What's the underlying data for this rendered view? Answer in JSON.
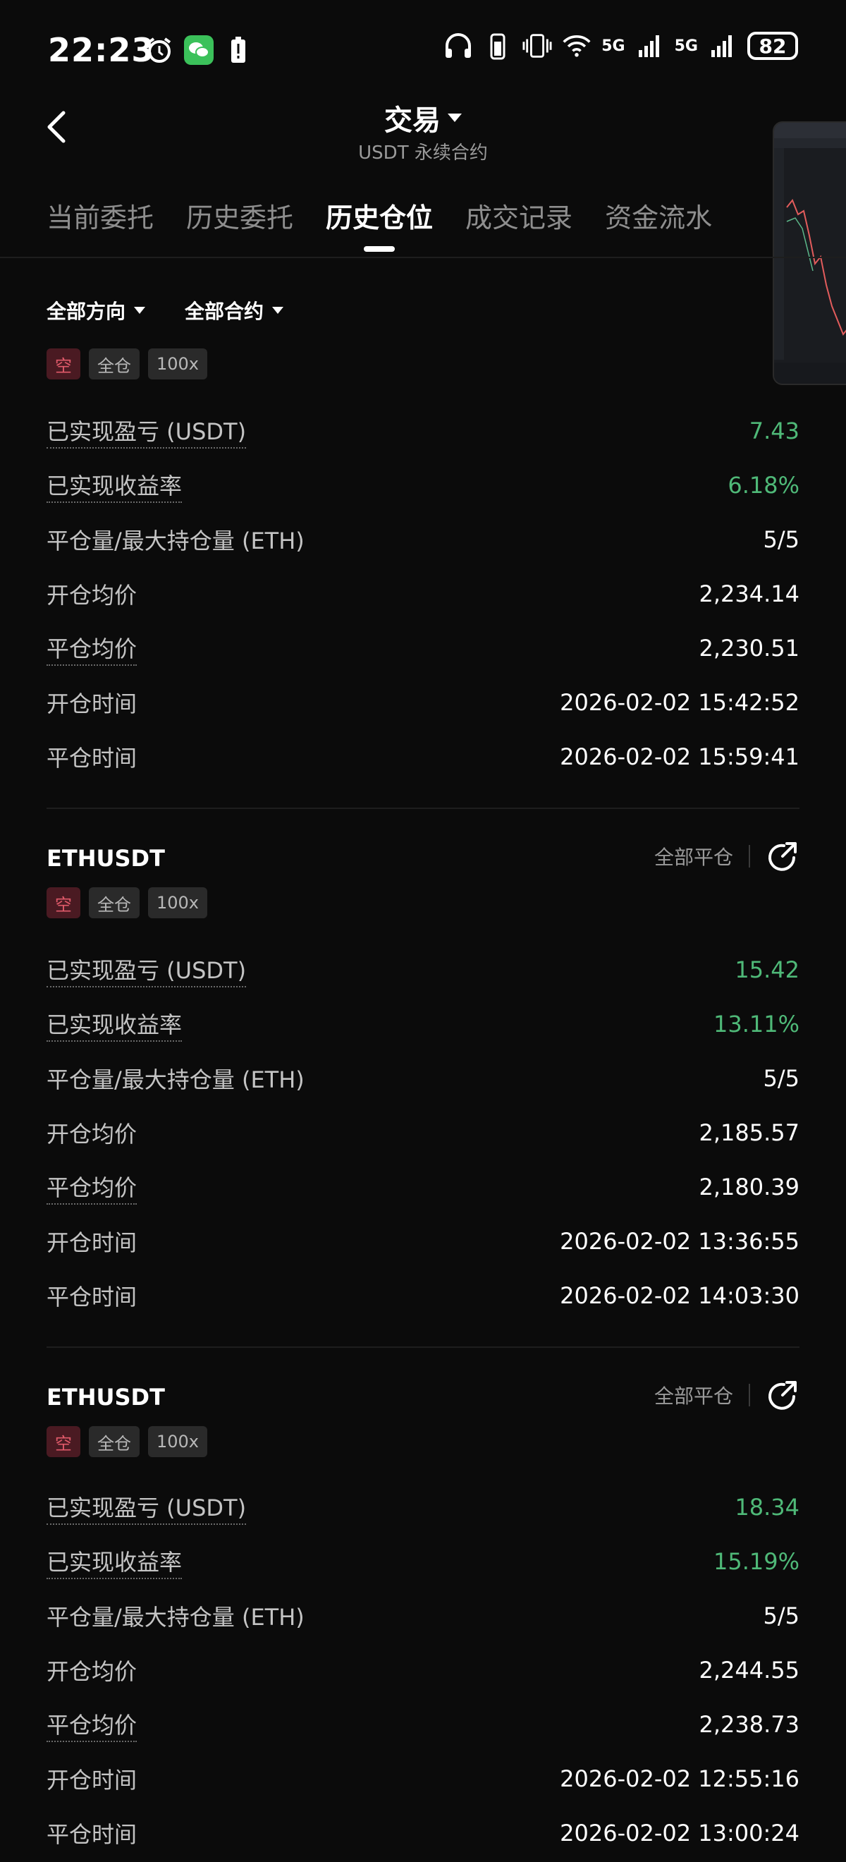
{
  "status_bar": {
    "time": "22:23",
    "network1": "5G",
    "network2": "5G",
    "battery": "82",
    "icons": [
      "alarm-icon",
      "wechat-icon",
      "battery-alert-icon",
      "headphones-icon",
      "watch-battery-icon",
      "vibrate-icon",
      "wifi-icon",
      "signal-icon",
      "signal-icon"
    ]
  },
  "header": {
    "title": "交易",
    "subtitle": "USDT 永续合约"
  },
  "tabs": [
    {
      "label": "当前委托"
    },
    {
      "label": "历史委托"
    },
    {
      "label": "历史仓位",
      "active": true
    },
    {
      "label": "成交记录"
    },
    {
      "label": "资金流水"
    }
  ],
  "filters": {
    "direction": "全部方向",
    "contract": "全部合约"
  },
  "labels": {
    "close_all": "全部平仓"
  },
  "positions": [
    {
      "symbol": "",
      "tags": [
        "空",
        "全仓",
        "100x"
      ],
      "rows": [
        {
          "label": "已实现盈亏 (USDT)",
          "value": "7.43"
        },
        {
          "label": "已实现收益率",
          "value": "6.18%"
        },
        {
          "label": "平仓量/最大持仓量 (ETH)",
          "value": "5/5"
        },
        {
          "label": "开仓均价",
          "value": "2,234.14"
        },
        {
          "label": "平仓均价",
          "value": "2,230.51"
        },
        {
          "label": "开仓时间",
          "value": "2026-02-02 15:42:52"
        },
        {
          "label": "平仓时间",
          "value": "2026-02-02 15:59:41"
        }
      ]
    },
    {
      "symbol": "ETHUSDT",
      "tags": [
        "空",
        "全仓",
        "100x"
      ],
      "rows": [
        {
          "label": "已实现盈亏 (USDT)",
          "value": "15.42"
        },
        {
          "label": "已实现收益率",
          "value": "13.11%"
        },
        {
          "label": "平仓量/最大持仓量 (ETH)",
          "value": "5/5"
        },
        {
          "label": "开仓均价",
          "value": "2,185.57"
        },
        {
          "label": "平仓均价",
          "value": "2,180.39"
        },
        {
          "label": "开仓时间",
          "value": "2026-02-02 13:36:55"
        },
        {
          "label": "平仓时间",
          "value": "2026-02-02 14:03:30"
        }
      ]
    },
    {
      "symbol": "ETHUSDT",
      "tags": [
        "空",
        "全仓",
        "100x"
      ],
      "rows": [
        {
          "label": "已实现盈亏 (USDT)",
          "value": "18.34"
        },
        {
          "label": "已实现收益率",
          "value": "15.19%"
        },
        {
          "label": "平仓量/最大持仓量 (ETH)",
          "value": "5/5"
        },
        {
          "label": "开仓均价",
          "value": "2,244.55"
        },
        {
          "label": "平仓均价",
          "value": "2,238.73"
        },
        {
          "label": "开仓时间",
          "value": "2026-02-02 12:55:16"
        },
        {
          "label": "平仓时间",
          "value": "2026-02-02 13:00:24"
        }
      ]
    }
  ],
  "colors": {
    "profit_green": "#4fb978",
    "short_red": "#e05a6a",
    "background": "#0b0b0b"
  }
}
